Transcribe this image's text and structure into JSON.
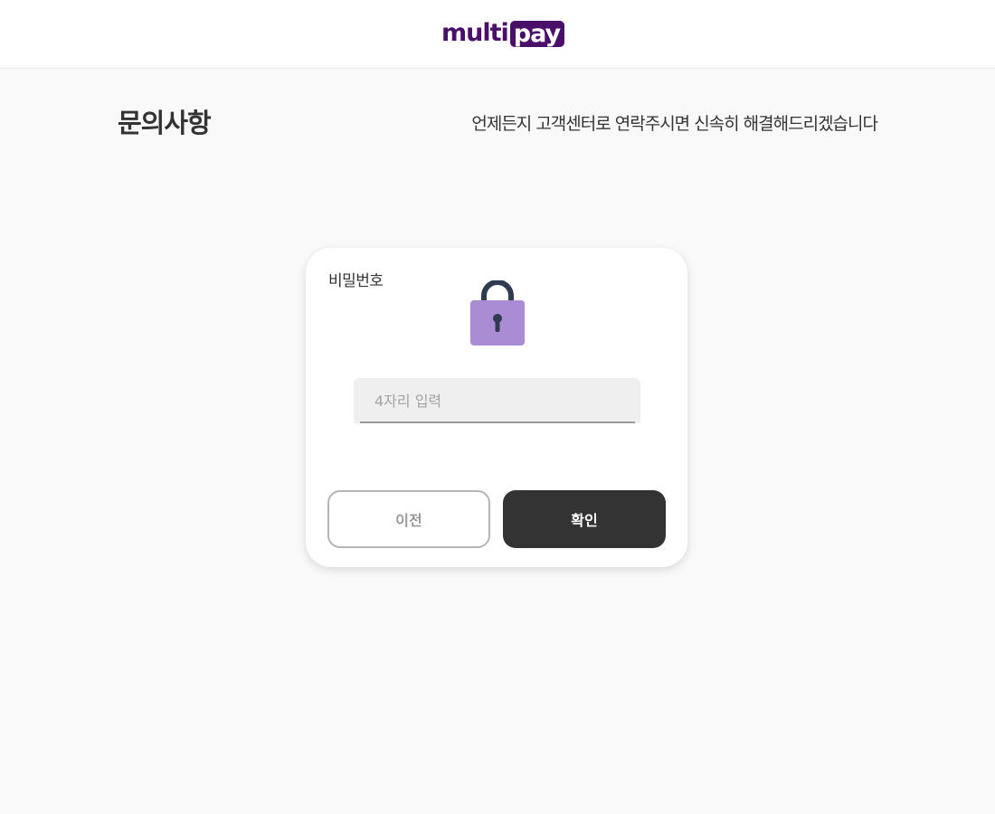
{
  "header": {
    "logo_multi": "multi",
    "logo_pay": "pay"
  },
  "page": {
    "title": "문의사항",
    "subtitle": "언제든지 고객센터로 연락주시면 신속히 해결해드리겠습니다"
  },
  "password_card": {
    "label": "비밀번호",
    "icon": "lock-icon",
    "input_value": "",
    "input_placeholder": "4자리 입력",
    "prev_button": "이전",
    "confirm_button": "확인"
  },
  "colors": {
    "brand": "#4a0f68",
    "lock_body": "#a98cd4",
    "lock_shackle": "#2f3b4e",
    "confirm_button": "#333333"
  }
}
